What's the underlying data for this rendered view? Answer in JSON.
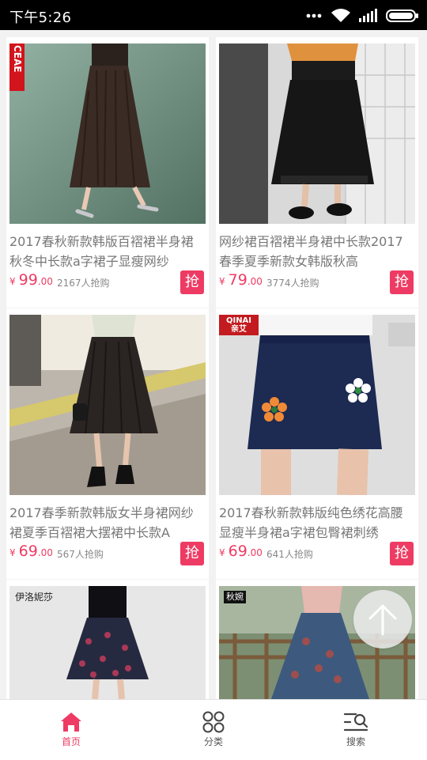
{
  "status_bar": {
    "time": "下午5:26"
  },
  "products": [
    {
      "title": "2017春秋新款韩版百褶裙半身裙秋冬中长款a字裙子显瘦网纱",
      "price_symbol": "¥",
      "price_int": "99",
      "price_dec": ".00",
      "sold": "2167人抢购",
      "grab_label": "抢",
      "brand_badge": "CEAE"
    },
    {
      "title": "网纱裙百褶裙半身裙中长款2017春季夏季新款女韩版秋高",
      "price_symbol": "¥",
      "price_int": "79",
      "price_dec": ".00",
      "sold": "3774人抢购",
      "grab_label": "抢"
    },
    {
      "title": "2017春季新款韩版女半身裙网纱裙夏季百褶裙大摆裙中长款A",
      "price_symbol": "¥",
      "price_int": "69",
      "price_dec": ".00",
      "sold": "567人抢购",
      "grab_label": "抢"
    },
    {
      "title": "2017春秋新款韩版纯色绣花高腰显瘦半身裙a字裙包臀裙刺绣",
      "price_symbol": "¥",
      "price_int": "69",
      "price_dec": ".00",
      "sold": "641人抢购",
      "grab_label": "抢",
      "brand_badge_en": "QINAI",
      "brand_badge_cn": "亲艾"
    },
    {
      "brand_badge": "伊洛妮莎"
    },
    {
      "brand_badge": "秋婉"
    }
  ],
  "tabs": [
    {
      "label": "首页",
      "icon": "home-icon",
      "active": true
    },
    {
      "label": "分类",
      "icon": "category-grid-icon",
      "active": false
    },
    {
      "label": "搜索",
      "icon": "search-icon",
      "active": false
    }
  ],
  "colors": {
    "accent": "#ee3b63",
    "status_bar": "#000000",
    "background": "#f2f2f2"
  }
}
